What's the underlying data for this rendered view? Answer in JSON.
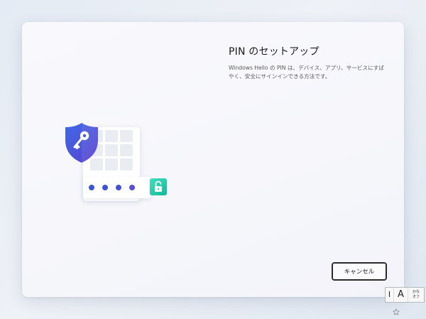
{
  "dialog": {
    "title": "PIN のセットアップ",
    "description": "Windows Hello の PIN は、デバイス、アプリ、サービスにすばやく、安全にサインインできる方法です。",
    "cancel_label": "キャンセル"
  },
  "illustration": {
    "shield_icon": "shield-key-icon",
    "lock_icon": "unlocked-padlock-icon",
    "pin_dot_count": 4,
    "colors": {
      "shield": "#4a5bd9",
      "pin_dots": "#3a55d8",
      "lock_tile": "#1fc7a8"
    }
  },
  "ime_toolbar": {
    "grip_label": "I",
    "mode_label": "A",
    "kana_label_line1": "かな",
    "kana_label_line2": "オフ",
    "pin_icon": "pin-icon"
  }
}
